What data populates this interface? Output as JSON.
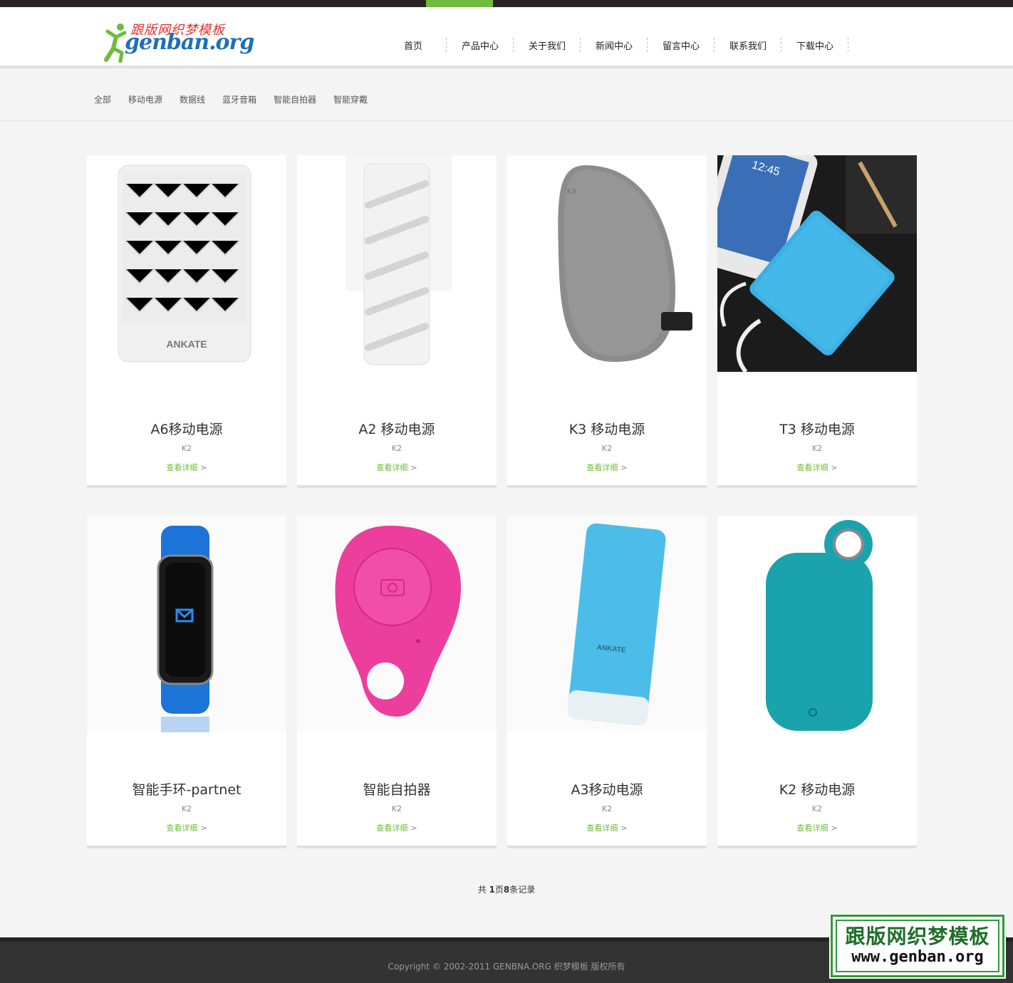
{
  "logo": {
    "text_cn": "跟版网织梦模板",
    "text_en": "genban.org"
  },
  "nav": {
    "items": [
      "首页",
      "产品中心",
      "关于我们",
      "新闻中心",
      "留言中心",
      "联系我们",
      "下载中心"
    ],
    "active": "产品中心"
  },
  "filters": [
    "全部",
    "移动电源",
    "数据线",
    "蓝牙音箱",
    "智能自拍器",
    "智能穿戴"
  ],
  "products": [
    {
      "title": "A6移动电源",
      "model": "K2",
      "more": "查看详细"
    },
    {
      "title": "A2 移动电源",
      "model": "K2",
      "more": "查看详细"
    },
    {
      "title": "K3 移动电源",
      "model": "K2",
      "more": "查看详细"
    },
    {
      "title": "T3 移动电源",
      "model": "K2",
      "more": "查看详细"
    },
    {
      "title": "智能手环-partnet",
      "model": "K2",
      "more": "查看详细"
    },
    {
      "title": "智能自拍器",
      "model": "K2",
      "more": "查看详细"
    },
    {
      "title": "A3移动电源",
      "model": "K2",
      "more": "查看详细"
    },
    {
      "title": "K2 移动电源",
      "model": "K2",
      "more": "查看详细"
    }
  ],
  "product_images": {
    "a6_brand": "ANKATE",
    "a3_brand": "ANKATE",
    "k3_mark": "K3",
    "t3_phone_time": "12:45"
  },
  "pager": {
    "prefix": "共 ",
    "pages": "1",
    "mid": "页",
    "records": "8",
    "suffix": "条记录"
  },
  "footer": {
    "copyright": "Copyright © 2002-2011 GENBNA.ORG 织梦模板 版权所有"
  },
  "watermark": {
    "line1": "跟版网织梦模板",
    "line2": "www.genban.org"
  },
  "colors": {
    "accent": "#6fbb3d",
    "topbar": "#2a2324",
    "footer": "#333333"
  }
}
